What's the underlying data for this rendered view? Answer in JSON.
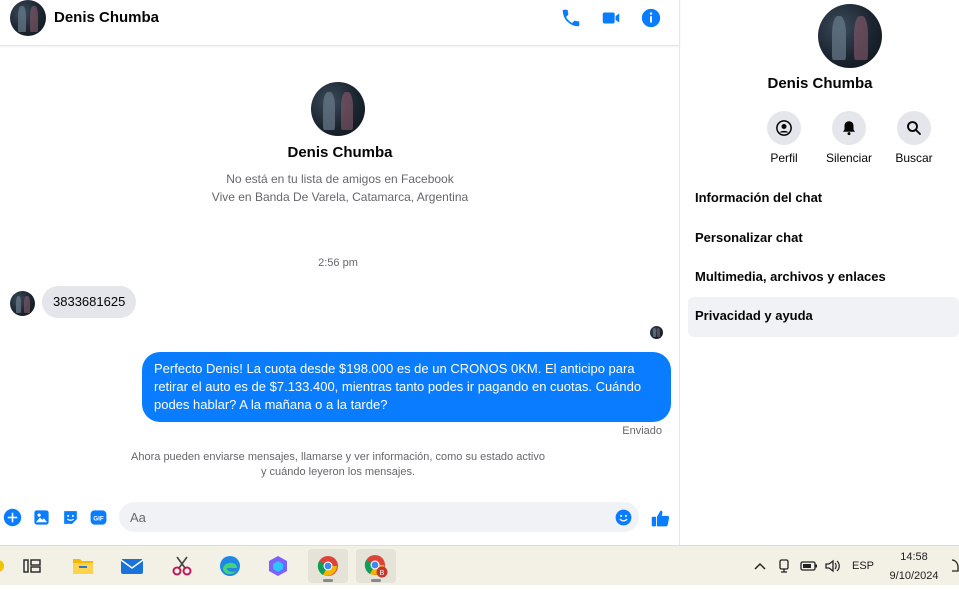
{
  "header": {
    "name": "Denis Chumba"
  },
  "conversation": {
    "profile_name": "Denis Chumba",
    "profile_line1": "No está en tu lista de amigos en Facebook",
    "profile_line2": "Vive en Banda De Varela, Catamarca, Argentina",
    "timestamp": "2:56 pm",
    "incoming_message": "3833681625",
    "outgoing_message": "Perfecto Denis! La cuota desde $198.000 es de un CRONOS 0KM. El anticipo para retirar el auto es de $7.133.400, mientras tanto podes ir pagando en cuotas. Cuándo podes hablar? A la mañana o a la tarde?",
    "status": "Enviado",
    "notice_line1": "Ahora pueden enviarse mensajes, llamarse y ver información, como su estado activo",
    "notice_line2": "y cuándo leyeron los mensajes."
  },
  "composer": {
    "placeholder": "Aa"
  },
  "info_panel": {
    "name": "Denis Chumba",
    "actions": [
      {
        "label": "Perfil",
        "icon": "profile-icon"
      },
      {
        "label": "Silenciar",
        "icon": "bell-icon"
      },
      {
        "label": "Buscar",
        "icon": "search-icon"
      }
    ],
    "menu": [
      {
        "label": "Información del chat"
      },
      {
        "label": "Personalizar chat"
      },
      {
        "label": "Multimedia, archivos y enlaces"
      },
      {
        "label": "Privacidad y ayuda"
      }
    ]
  },
  "taskbar": {
    "language": "ESP",
    "time": "14:58",
    "date": "9/10/2024",
    "apps": [
      "task-view-icon",
      "file-explorer-icon",
      "mail-icon",
      "snipping-tool-icon",
      "edge-icon",
      "copilot-icon",
      "chrome-icon",
      "chrome-profile-icon"
    ]
  },
  "colors": {
    "accent": "#0a7cff",
    "muted": "#65676b",
    "bubble_gray": "#e4e6eb"
  }
}
